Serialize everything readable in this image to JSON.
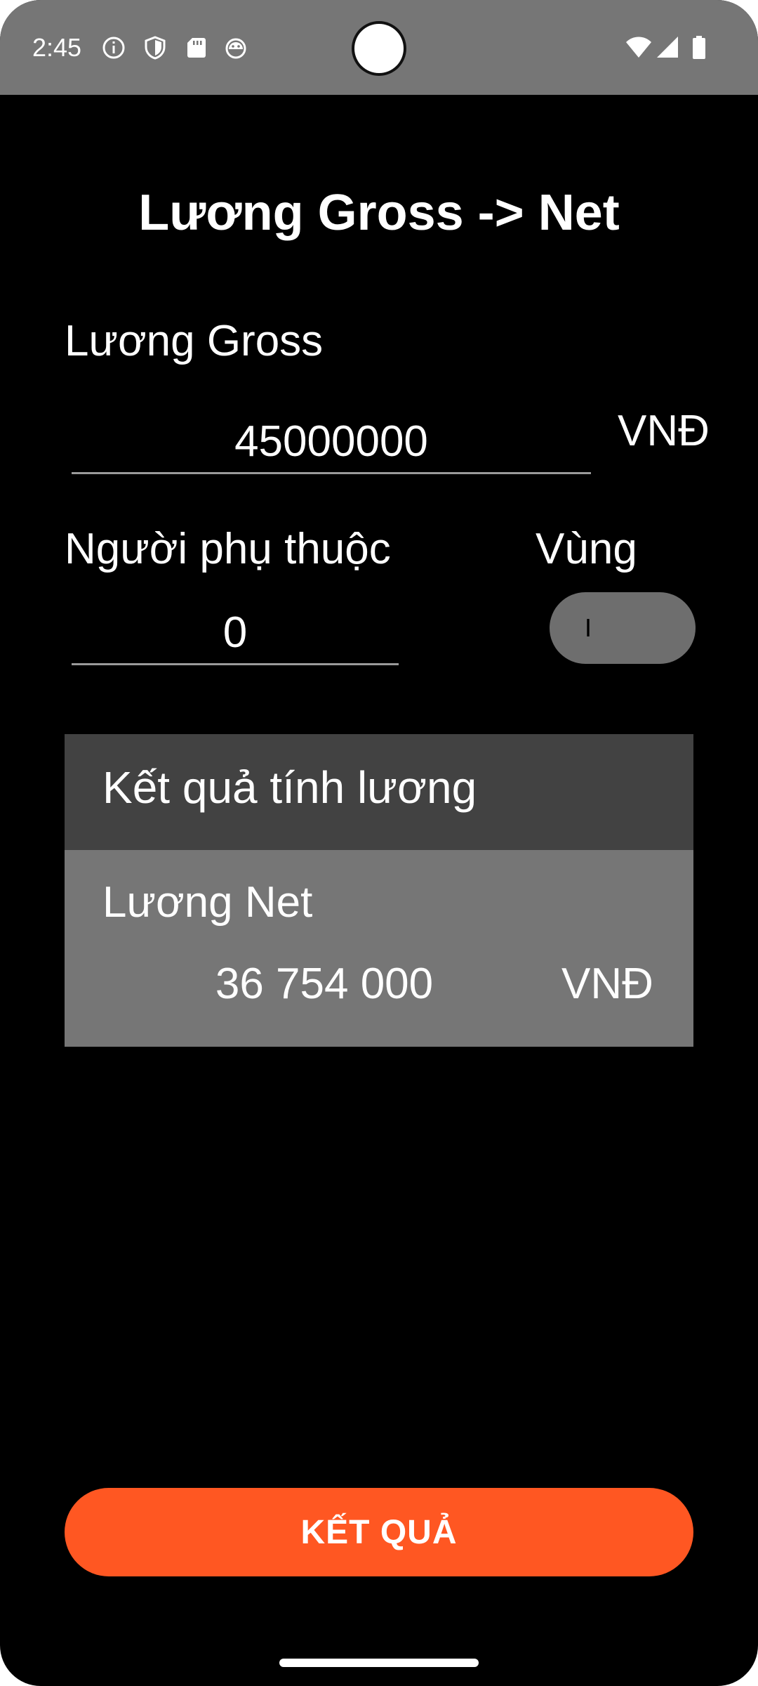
{
  "status_bar": {
    "time": "2:45",
    "left_icons": [
      "info-icon",
      "shield-icon",
      "sd-card-icon",
      "android-debug-icon"
    ],
    "right_icons": [
      "wifi-icon",
      "cellular-signal-icon",
      "battery-icon"
    ]
  },
  "page": {
    "title": "Lương Gross -> Net"
  },
  "form": {
    "gross_label": "Lương Gross",
    "gross_value": "45000000",
    "gross_unit": "VNĐ",
    "dependents_label": "Người phụ thuộc",
    "dependents_value": "0",
    "region_label": "Vùng",
    "region_value": "I"
  },
  "result": {
    "header": "Kết quả tính lương",
    "net_label": "Lương Net",
    "net_value": "36 754 000",
    "net_unit": "VNĐ"
  },
  "actions": {
    "submit_label": "KẾT QUẢ"
  },
  "colors": {
    "accent": "#FF5722",
    "status_bar": "#767676",
    "card_header": "#424242",
    "card_body": "#767676",
    "background": "#000000"
  }
}
